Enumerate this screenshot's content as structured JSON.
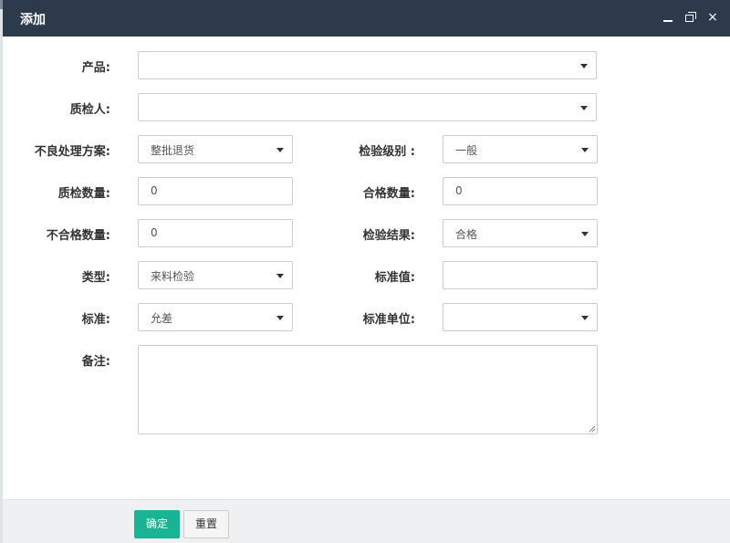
{
  "dialog": {
    "title": "添加",
    "controls": {
      "minimize": "minimize-icon",
      "maximize": "maximize-icon",
      "close": "×"
    }
  },
  "form": {
    "product": {
      "label": "产品:",
      "value": ""
    },
    "inspector": {
      "label": "质检人:",
      "value": ""
    },
    "defect_plan": {
      "label": "不良处理方案:",
      "value": "整批退货"
    },
    "inspection_level": {
      "label": "检验级别 :",
      "value": "一般"
    },
    "inspected_qty": {
      "label": "质检数量:",
      "value": "0"
    },
    "passed_qty": {
      "label": "合格数量:",
      "value": "0"
    },
    "failed_qty": {
      "label": "不合格数量:",
      "value": "0"
    },
    "inspection_result": {
      "label": "检验结果:",
      "value": "合格"
    },
    "type": {
      "label": "类型:",
      "value": "来料检验"
    },
    "standard_value": {
      "label": "标准值:",
      "value": ""
    },
    "standard": {
      "label": "标准:",
      "value": "允差"
    },
    "standard_unit": {
      "label": "标准单位:",
      "value": ""
    },
    "remark": {
      "label": "备注:",
      "value": ""
    }
  },
  "footer": {
    "confirm_label": "确定",
    "reset_label": "重置"
  },
  "colors": {
    "titlebar": "#2d3a4b",
    "primary": "#1ab394",
    "footer_bg": "#eef0f2"
  }
}
